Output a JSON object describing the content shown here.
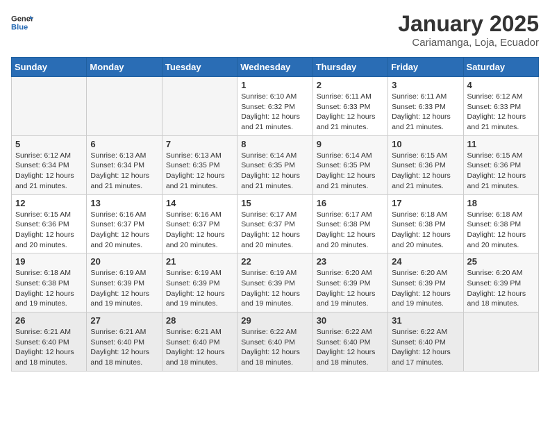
{
  "header": {
    "logo_line1": "General",
    "logo_line2": "Blue",
    "title": "January 2025",
    "subtitle": "Cariamanga, Loja, Ecuador"
  },
  "weekdays": [
    "Sunday",
    "Monday",
    "Tuesday",
    "Wednesday",
    "Thursday",
    "Friday",
    "Saturday"
  ],
  "weeks": [
    [
      {
        "day": "",
        "info": ""
      },
      {
        "day": "",
        "info": ""
      },
      {
        "day": "",
        "info": ""
      },
      {
        "day": "1",
        "info": "Sunrise: 6:10 AM\nSunset: 6:32 PM\nDaylight: 12 hours and 21 minutes."
      },
      {
        "day": "2",
        "info": "Sunrise: 6:11 AM\nSunset: 6:33 PM\nDaylight: 12 hours and 21 minutes."
      },
      {
        "day": "3",
        "info": "Sunrise: 6:11 AM\nSunset: 6:33 PM\nDaylight: 12 hours and 21 minutes."
      },
      {
        "day": "4",
        "info": "Sunrise: 6:12 AM\nSunset: 6:33 PM\nDaylight: 12 hours and 21 minutes."
      }
    ],
    [
      {
        "day": "5",
        "info": "Sunrise: 6:12 AM\nSunset: 6:34 PM\nDaylight: 12 hours and 21 minutes."
      },
      {
        "day": "6",
        "info": "Sunrise: 6:13 AM\nSunset: 6:34 PM\nDaylight: 12 hours and 21 minutes."
      },
      {
        "day": "7",
        "info": "Sunrise: 6:13 AM\nSunset: 6:35 PM\nDaylight: 12 hours and 21 minutes."
      },
      {
        "day": "8",
        "info": "Sunrise: 6:14 AM\nSunset: 6:35 PM\nDaylight: 12 hours and 21 minutes."
      },
      {
        "day": "9",
        "info": "Sunrise: 6:14 AM\nSunset: 6:35 PM\nDaylight: 12 hours and 21 minutes."
      },
      {
        "day": "10",
        "info": "Sunrise: 6:15 AM\nSunset: 6:36 PM\nDaylight: 12 hours and 21 minutes."
      },
      {
        "day": "11",
        "info": "Sunrise: 6:15 AM\nSunset: 6:36 PM\nDaylight: 12 hours and 21 minutes."
      }
    ],
    [
      {
        "day": "12",
        "info": "Sunrise: 6:15 AM\nSunset: 6:36 PM\nDaylight: 12 hours and 20 minutes."
      },
      {
        "day": "13",
        "info": "Sunrise: 6:16 AM\nSunset: 6:37 PM\nDaylight: 12 hours and 20 minutes."
      },
      {
        "day": "14",
        "info": "Sunrise: 6:16 AM\nSunset: 6:37 PM\nDaylight: 12 hours and 20 minutes."
      },
      {
        "day": "15",
        "info": "Sunrise: 6:17 AM\nSunset: 6:37 PM\nDaylight: 12 hours and 20 minutes."
      },
      {
        "day": "16",
        "info": "Sunrise: 6:17 AM\nSunset: 6:38 PM\nDaylight: 12 hours and 20 minutes."
      },
      {
        "day": "17",
        "info": "Sunrise: 6:18 AM\nSunset: 6:38 PM\nDaylight: 12 hours and 20 minutes."
      },
      {
        "day": "18",
        "info": "Sunrise: 6:18 AM\nSunset: 6:38 PM\nDaylight: 12 hours and 20 minutes."
      }
    ],
    [
      {
        "day": "19",
        "info": "Sunrise: 6:18 AM\nSunset: 6:38 PM\nDaylight: 12 hours and 19 minutes."
      },
      {
        "day": "20",
        "info": "Sunrise: 6:19 AM\nSunset: 6:39 PM\nDaylight: 12 hours and 19 minutes."
      },
      {
        "day": "21",
        "info": "Sunrise: 6:19 AM\nSunset: 6:39 PM\nDaylight: 12 hours and 19 minutes."
      },
      {
        "day": "22",
        "info": "Sunrise: 6:19 AM\nSunset: 6:39 PM\nDaylight: 12 hours and 19 minutes."
      },
      {
        "day": "23",
        "info": "Sunrise: 6:20 AM\nSunset: 6:39 PM\nDaylight: 12 hours and 19 minutes."
      },
      {
        "day": "24",
        "info": "Sunrise: 6:20 AM\nSunset: 6:39 PM\nDaylight: 12 hours and 19 minutes."
      },
      {
        "day": "25",
        "info": "Sunrise: 6:20 AM\nSunset: 6:39 PM\nDaylight: 12 hours and 18 minutes."
      }
    ],
    [
      {
        "day": "26",
        "info": "Sunrise: 6:21 AM\nSunset: 6:40 PM\nDaylight: 12 hours and 18 minutes."
      },
      {
        "day": "27",
        "info": "Sunrise: 6:21 AM\nSunset: 6:40 PM\nDaylight: 12 hours and 18 minutes."
      },
      {
        "day": "28",
        "info": "Sunrise: 6:21 AM\nSunset: 6:40 PM\nDaylight: 12 hours and 18 minutes."
      },
      {
        "day": "29",
        "info": "Sunrise: 6:22 AM\nSunset: 6:40 PM\nDaylight: 12 hours and 18 minutes."
      },
      {
        "day": "30",
        "info": "Sunrise: 6:22 AM\nSunset: 6:40 PM\nDaylight: 12 hours and 18 minutes."
      },
      {
        "day": "31",
        "info": "Sunrise: 6:22 AM\nSunset: 6:40 PM\nDaylight: 12 hours and 17 minutes."
      },
      {
        "day": "",
        "info": ""
      }
    ]
  ]
}
